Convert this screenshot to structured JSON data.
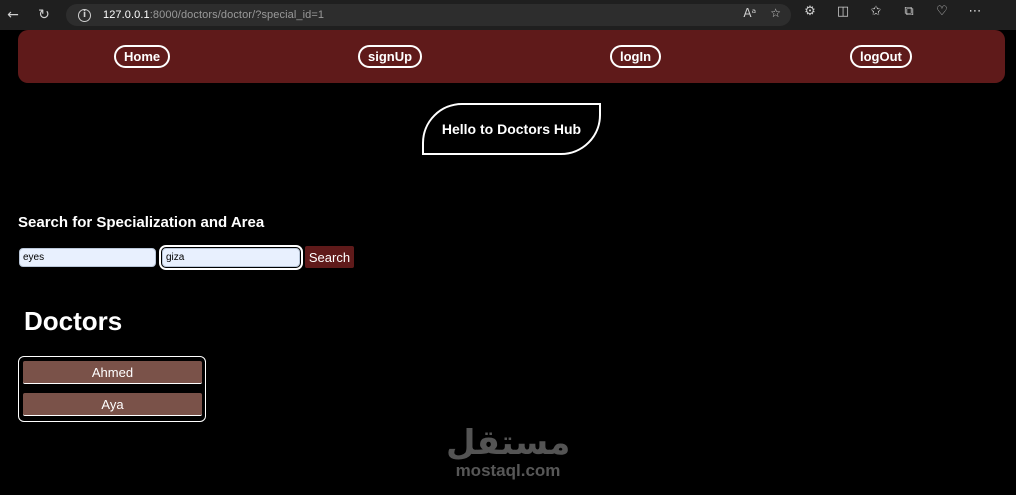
{
  "browser": {
    "url_host": "127.0.0.1",
    "url_rest": ":8000/doctors/doctor/?special_id=1"
  },
  "nav": {
    "home": "Home",
    "signup": "signUp",
    "login": "logIn",
    "logout": "logOut"
  },
  "hero": {
    "title": "Hello to Doctors Hub"
  },
  "search": {
    "title": "Search for Specialization and Area",
    "specialization_value": "eyes",
    "area_value": "giza",
    "button": "Search"
  },
  "doctors": {
    "title": "Doctors",
    "items": [
      {
        "name": "Ahmed"
      },
      {
        "name": "Aya"
      }
    ]
  },
  "watermark": {
    "arabic": "مستقل",
    "latin": "mostaql.com"
  },
  "colors": {
    "navbar": "#5f1a1a",
    "doctor_item": "#7a5249",
    "background": "#000000"
  }
}
